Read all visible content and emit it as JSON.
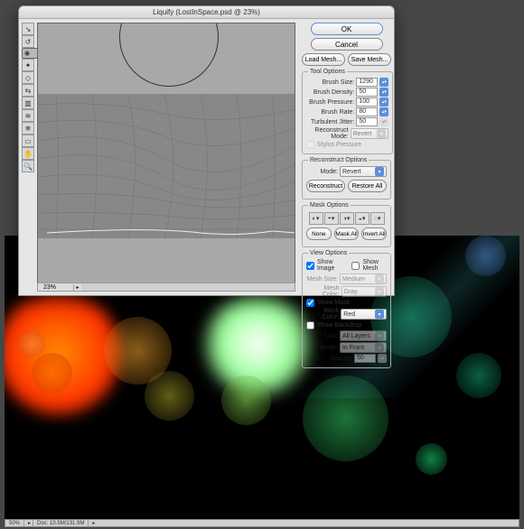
{
  "dialog": {
    "title": "Liquify (LostInSpace.psd @ 23%)",
    "ok": "OK",
    "cancel": "Cancel",
    "load_mesh": "Load Mesh...",
    "save_mesh": "Save Mesh...",
    "zoom": "23%"
  },
  "tool_options": {
    "legend": "Tool Options",
    "brush_size_lbl": "Brush Size:",
    "brush_size": "1290",
    "brush_density_lbl": "Brush Density:",
    "brush_density": "50",
    "brush_pressure_lbl": "Brush Pressure:",
    "brush_pressure": "100",
    "brush_rate_lbl": "Brush Rate:",
    "brush_rate": "80",
    "turb_jitter_lbl": "Turbulent Jitter:",
    "turb_jitter": "50",
    "recon_mode_lbl": "Reconstruct Mode:",
    "recon_mode": "Revert",
    "stylus": "Stylus Pressure"
  },
  "reconstruct": {
    "legend": "Reconstruct Options",
    "mode_lbl": "Mode:",
    "mode": "Revert",
    "reconstruct": "Reconstruct",
    "restore": "Restore All"
  },
  "mask": {
    "legend": "Mask Options",
    "none": "None",
    "mask_all": "Mask All",
    "invert_all": "Invert All"
  },
  "view": {
    "legend": "View Options",
    "show_image": "Show Image",
    "show_mesh": "Show Mesh",
    "mesh_size_lbl": "Mesh Size:",
    "mesh_size": "Medium",
    "mesh_color_lbl": "Mesh Color:",
    "mesh_color": "Gray",
    "show_mask": "Show Mask",
    "mask_color_lbl": "Mask Color:",
    "mask_color": "Red",
    "show_backdrop": "Show Backdrop",
    "use_lbl": "Use:",
    "use": "All Layers",
    "backdrop_mode_lbl": "Mode:",
    "backdrop_mode": "In Front",
    "opacity_lbl": "Opacity:",
    "opacity": "50"
  },
  "status": {
    "zoom": "50%",
    "doc": "Doc: 10.5M/131.9M"
  }
}
